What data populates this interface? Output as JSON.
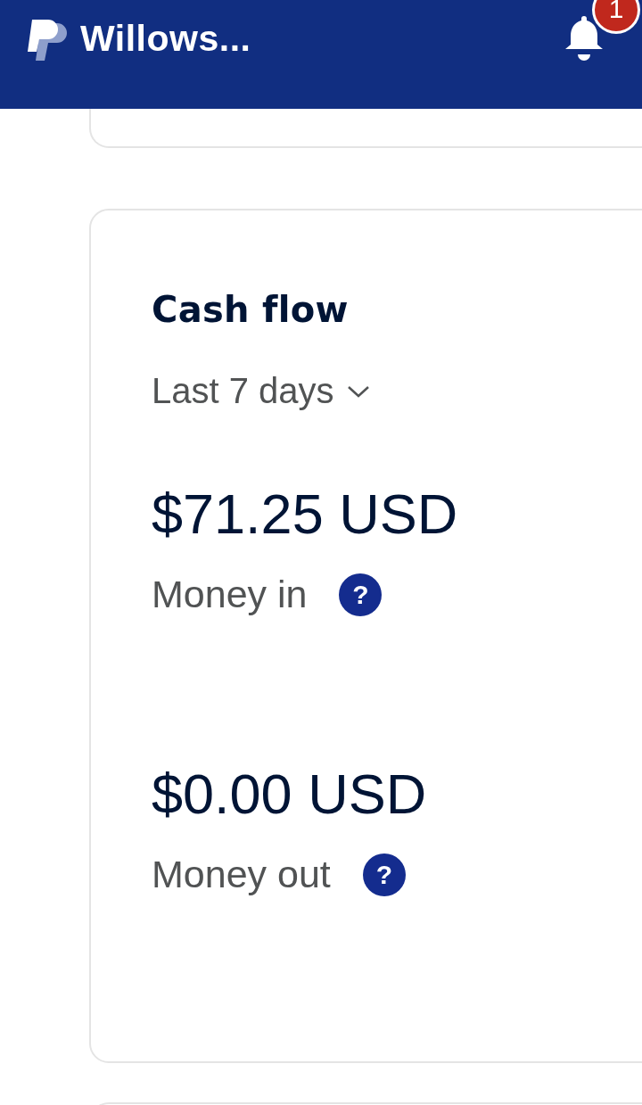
{
  "header": {
    "title": "Willows...",
    "notification_count": "1"
  },
  "cash_flow": {
    "title": "Cash flow",
    "period": "Last 7 days",
    "figures": [
      {
        "amount": "$71.25 USD",
        "label": "Money in",
        "help": "?"
      },
      {
        "amount": "$0.00 USD",
        "label": "Money out",
        "help": "?"
      }
    ]
  }
}
